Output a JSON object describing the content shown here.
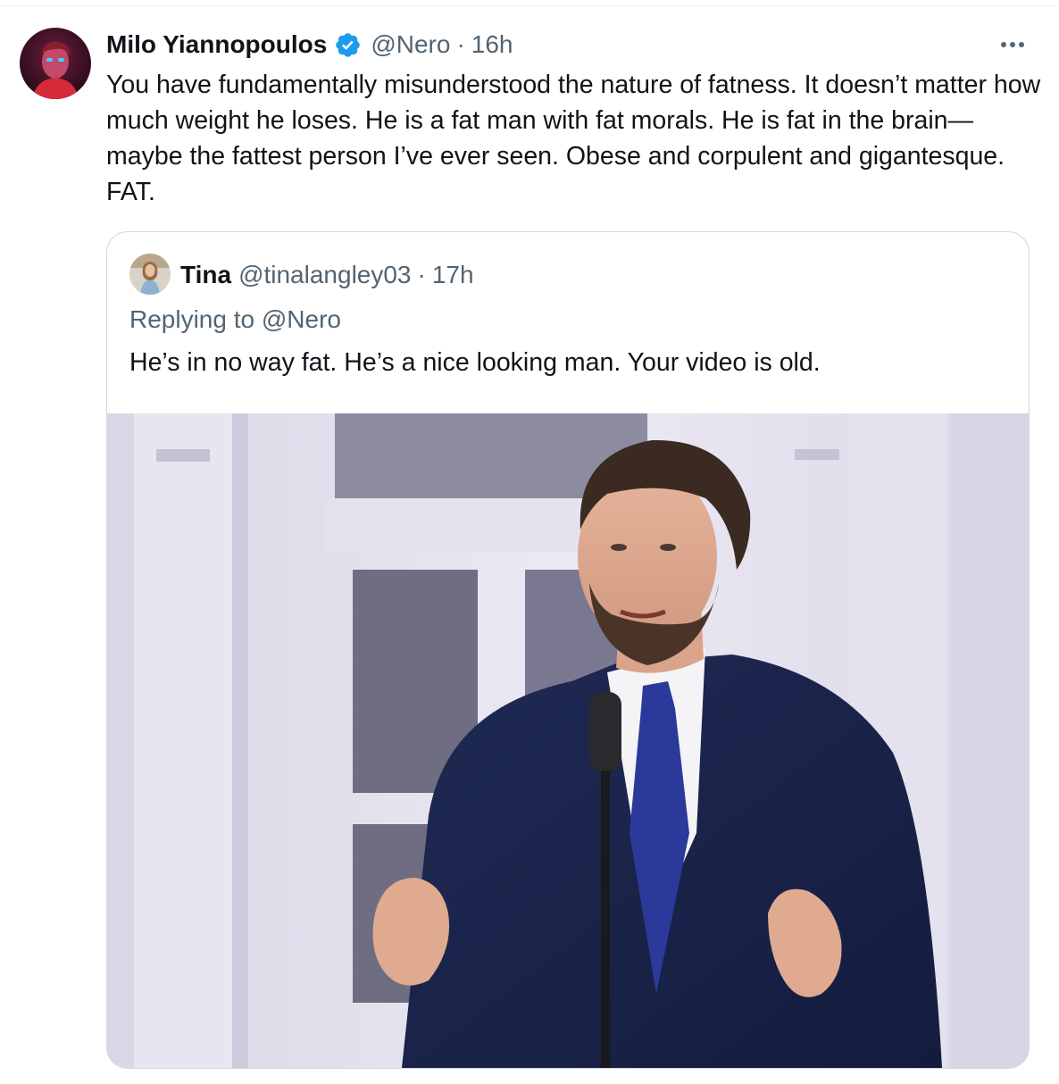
{
  "tweet": {
    "author_name": "Milo Yiannopoulos",
    "handle": "@Nero",
    "separator": "·",
    "time": "16h",
    "text": "You have fundamentally misunderstood the nature of fatness. It doesn’t matter how much weight he loses. He is a fat man with fat morals. He is fat in the brain—maybe the fattest person I’ve ever seen. Obese and corpulent and gigantesque. FAT.",
    "verified": true,
    "more_icon": "more-horizontal-icon"
  },
  "quoted_tweet": {
    "author_name": "Tina",
    "handle": "@tinalangley03",
    "separator": "·",
    "time": "17h",
    "replying_to": "Replying to @Nero",
    "text": "He’s in no way fat. He’s a nice looking man. Your video is old."
  },
  "colors": {
    "text_primary": "#0f1419",
    "text_secondary": "#536471",
    "verified_blue": "#1d9bf0",
    "border": "#cfd9de"
  }
}
